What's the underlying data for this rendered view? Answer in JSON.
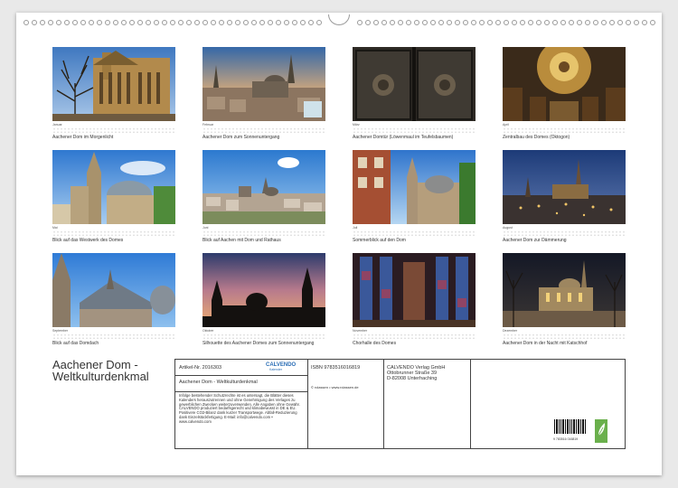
{
  "calendar": {
    "title_line1": "Aachener Dom -",
    "title_line2": "Weltkulturdenkmal",
    "months": [
      {
        "month": "Januar",
        "caption": "Aachener Dom im Morgenlicht"
      },
      {
        "month": "Februar",
        "caption": "Aachener Dom zum Sonnenuntergang"
      },
      {
        "month": "März",
        "caption": "Aachener Domtür (Löwenmaul im Teufelsbaumen)"
      },
      {
        "month": "April",
        "caption": "Zentralbau des Domes (Oktogon)"
      },
      {
        "month": "Mai",
        "caption": "Blick auf das Westwerk des Domes"
      },
      {
        "month": "Juni",
        "caption": "Blick auf Aachen mit Dom und Rathaus"
      },
      {
        "month": "Juli",
        "caption": "Sommerblick auf den Dom"
      },
      {
        "month": "August",
        "caption": "Aachener Dom zur Dämmerung"
      },
      {
        "month": "September",
        "caption": "Blick auf das Domdach"
      },
      {
        "month": "Oktober",
        "caption": "Silhouette des Aachener Domes zum Sonnenuntergang"
      },
      {
        "month": "November",
        "caption": "Chorhalle des Domes"
      },
      {
        "month": "Dezember",
        "caption": "Aachener Dom in der Nacht mit Katschhof"
      }
    ]
  },
  "info": {
    "article": "Artikel-Nr. 2016303",
    "logo": "CALVENDO",
    "logo_sub": "Kalender",
    "name": "Aachener Dom - Weltkulturdenkmal",
    "notice": "Infolge bestehender Schutzrechte ist es untersagt, die Blätter dieses Kalenders herauszutrennen und ohne Genehmigung des Verlages zu gewerblichen Zwecken weiterzuverwenden. Alle Angaben ohne Gewähr. CALVENDO produziert bedarfsgerecht und klimabewusst in DE & EU. Positivere CO2-Bilanz dank kurzer Transportwege. Abfall-Reduzierung dank Einzelstückfertigung. E-Mail: info@calvendo.com • www.calvendo.com",
    "isbn": "ISBN 9783516016819",
    "copyright": "© rclassen • www.rclassen.de",
    "publisher_name": "CALVENDO Verlag GmbH",
    "publisher_street": "Ottobrunner Straße 39",
    "publisher_city": "D-82008 Unterhaching",
    "barcode_text": "9 783516 016819"
  },
  "colors": {
    "accent": "#6ab04c",
    "brand": "#2a6db5"
  }
}
